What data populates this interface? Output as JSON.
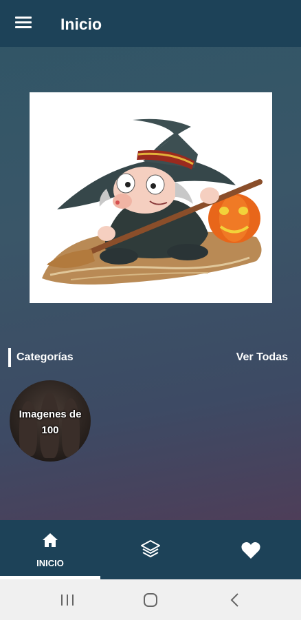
{
  "appbar": {
    "title": "Inicio",
    "menu_icon": "hamburger-menu-icon"
  },
  "hero": {
    "image": "witch-figurine-illustration"
  },
  "categories": {
    "title": "Categorías",
    "see_all": "Ver Todas",
    "items": [
      {
        "label": "Imagenes de 100"
      }
    ]
  },
  "bottom_nav": {
    "items": [
      {
        "label": "INICIO",
        "icon": "home-icon",
        "selected": true
      },
      {
        "label": "",
        "icon": "layers-icon",
        "selected": false
      },
      {
        "label": "",
        "icon": "heart-icon",
        "selected": false
      }
    ]
  },
  "system_nav": {
    "buttons": [
      "recents-icon",
      "home-circle-icon",
      "back-icon"
    ]
  },
  "colors": {
    "bar": "#1d4258",
    "system_bar": "#f0f0f0"
  }
}
